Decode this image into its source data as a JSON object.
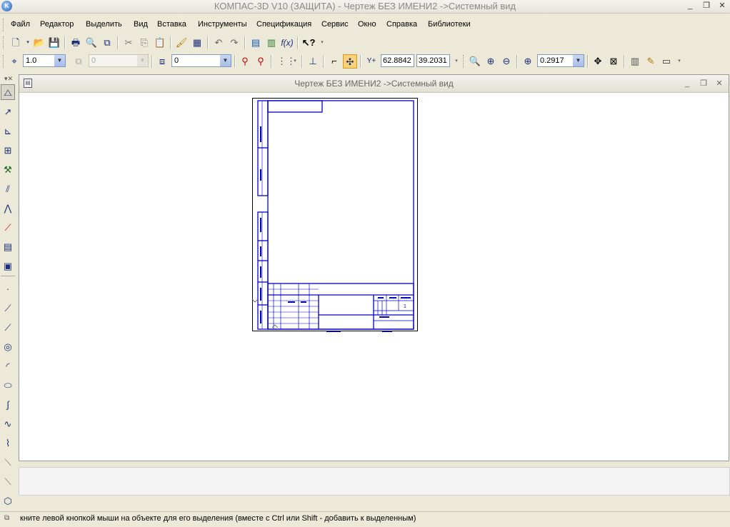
{
  "window": {
    "title": "КОМПАС-3D V10 (ЗАЩИТА) - Чертеж БЕЗ ИМЕНИ2 ->Системный вид",
    "minimize": "_",
    "restore": "❐",
    "close": "✕"
  },
  "menu": [
    {
      "label": "Файл"
    },
    {
      "label": "Редактор"
    },
    {
      "label": "Выделить"
    },
    {
      "label": "Вид"
    },
    {
      "label": "Вставка"
    },
    {
      "label": "Инструменты"
    },
    {
      "label": "Спецификация"
    },
    {
      "label": "Сервис"
    },
    {
      "label": "Окно"
    },
    {
      "label": "Справка"
    },
    {
      "label": "Библиотеки"
    }
  ],
  "toolbar2": {
    "step_value": "1.0",
    "disabled_value": "0",
    "layer_value": "0",
    "coord_x": "62.8842",
    "coord_y": "39.2031",
    "zoom_value": "0.2917",
    "coord_label": "Y+"
  },
  "document": {
    "title": "Чертеж БЕЗ ИМЕНИ2 ->Системный вид",
    "sheet_number_label": "1"
  },
  "status": {
    "text": "кните левой кнопкой мыши на объекте для его выделения (вместе с Ctrl или Shift - добавить к выделенным)"
  },
  "colors": {
    "drawing_line": "#0000c8",
    "title_text": "#8a8a8a"
  }
}
